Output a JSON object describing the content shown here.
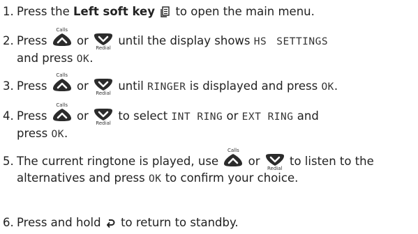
{
  "key_labels": {
    "up_key": "Calls",
    "down_key": "Redial"
  },
  "icons": {
    "left_soft_key": "menu-page-icon",
    "up_key": "up-arrow-key-icon",
    "down_key": "down-arrow-key-icon",
    "end_key": "return-arrow-icon"
  },
  "colors": {
    "text": "#222222",
    "key_fill": "#2b2b2b"
  },
  "steps": [
    {
      "num": "1.",
      "a": "Press the ",
      "b": "Left soft key",
      "c": " to open the main menu."
    },
    {
      "num": "2.",
      "a": "Press",
      "b": "or",
      "c": "until the display shows",
      "d": "HS",
      "e": "SETTINGS",
      "f": "and press",
      "g": "OK",
      "h": "."
    },
    {
      "num": "3.",
      "a": "Press",
      "b": "or",
      "c": "until",
      "d": "RINGER",
      "e": "is displayed and press",
      "f": "OK",
      "g": "."
    },
    {
      "num": "4.",
      "a": "Press",
      "b": "or",
      "c": "to select",
      "d": "INT RING",
      "e": "or",
      "f": "EXT RING",
      "g": "and",
      "h": "press",
      "i": "OK",
      "j": "."
    },
    {
      "num": "5.",
      "a": "The current ringtone is played, use",
      "b": "or",
      "c": "to listen to the",
      "d": "alternatives and press",
      "e": "OK",
      "f": "to confirm your choice."
    },
    {
      "num": "6.",
      "a": "Press and hold",
      "b": "to return to standby."
    }
  ]
}
